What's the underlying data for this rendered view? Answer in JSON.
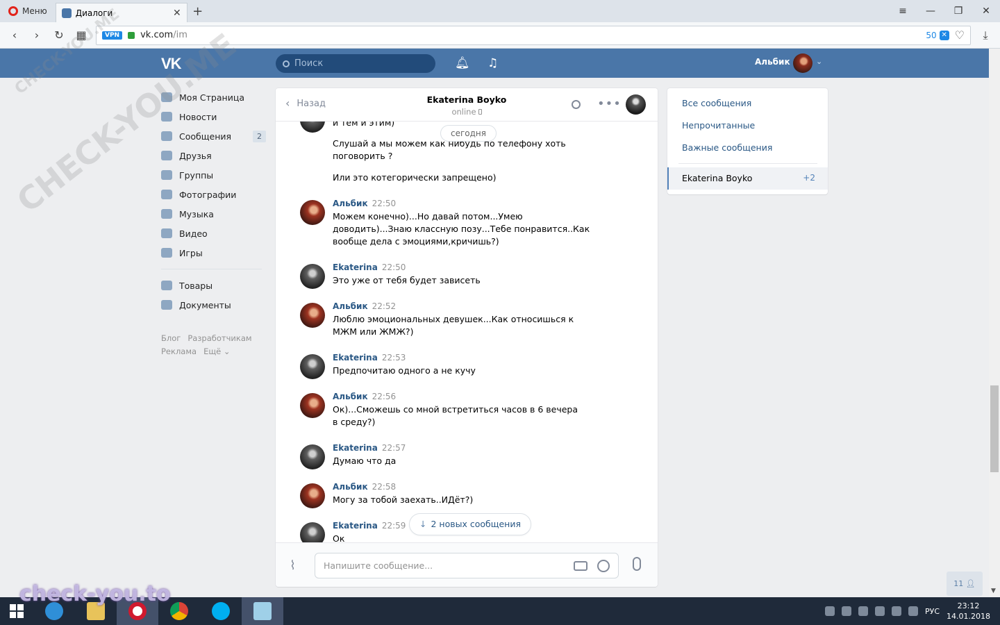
{
  "browser": {
    "menu_label": "Меню",
    "tab_title": "Диалоги",
    "new_tab": "+",
    "vpn_label": "VPN",
    "url_host": "vk.com",
    "url_path": "/im",
    "ad_block_count": "50"
  },
  "vk_header": {
    "logo": "VK",
    "search_placeholder": "Поиск",
    "user_name": "Альбик"
  },
  "left_nav": {
    "items": [
      {
        "label": "Моя Страница"
      },
      {
        "label": "Новости"
      },
      {
        "label": "Сообщения",
        "badge": "2"
      },
      {
        "label": "Друзья"
      },
      {
        "label": "Группы"
      },
      {
        "label": "Фотографии"
      },
      {
        "label": "Музыка"
      },
      {
        "label": "Видео"
      },
      {
        "label": "Игры"
      }
    ],
    "items2": [
      {
        "label": "Товары"
      },
      {
        "label": "Документы"
      }
    ],
    "footer": {
      "blog": "Блог",
      "dev": "Разработчикам",
      "ads": "Реклама",
      "more": "Ещё ⌄"
    }
  },
  "chat": {
    "back_label": "Назад",
    "peer_name": "Ekaterina Boyko",
    "peer_status": "online",
    "date_separator": "сегодня",
    "cont_lines": [
      "и тем и этим)",
      "Слушай а мы можем как нибудь по телефону хоть поговорить ?",
      "Или это котегорически запрещено)"
    ],
    "messages": [
      {
        "author": "Альбик",
        "time": "22:50",
        "text": "Можем конечно)...Но давай потом...Умею доводить)...Знаю классную позу...Тебе понравится..Как вообще дела с эмоциями,кричишь?)"
      },
      {
        "author": "Ekaterina",
        "time": "22:50",
        "text": "Это уже от тебя будет зависеть"
      },
      {
        "author": "Альбик",
        "time": "22:52",
        "text": "Люблю эмоциональных девушек...Как относишься к МЖМ или ЖМЖ?)"
      },
      {
        "author": "Ekaterina",
        "time": "22:53",
        "text": "Предпочитаю одного а не кучу"
      },
      {
        "author": "Альбик",
        "time": "22:56",
        "text": "Ок)...Сможешь со мной встретиться часов в 6 вечера в среду?)"
      },
      {
        "author": "Ekaterina",
        "time": "22:57",
        "text": "Думаю что да"
      },
      {
        "author": "Альбик",
        "time": "22:58",
        "text": "Могу за тобой заехать..ИДёт?)"
      },
      {
        "author": "Ekaterina",
        "time": "22:59",
        "text": "Ок"
      }
    ],
    "new_messages_label": "2 новых сообщения",
    "input_placeholder": "Напишите сообщение..."
  },
  "filters": {
    "all": "Все сообщения",
    "unread": "Непрочитанные",
    "important": "Важные сообщения",
    "active_dialog": "Ekaterina Boyko",
    "active_count": "+2"
  },
  "online_friends_count": "11",
  "watermark": {
    "diagonal": "CHECK-YOU.ME",
    "bottom": "check-you.to"
  },
  "taskbar": {
    "lang": "РУС",
    "time": "23:12",
    "date": "14.01.2018"
  },
  "colors": {
    "vk_blue": "#4a76a8",
    "link": "#2a5885",
    "taskbar": "#1f2a3a"
  }
}
